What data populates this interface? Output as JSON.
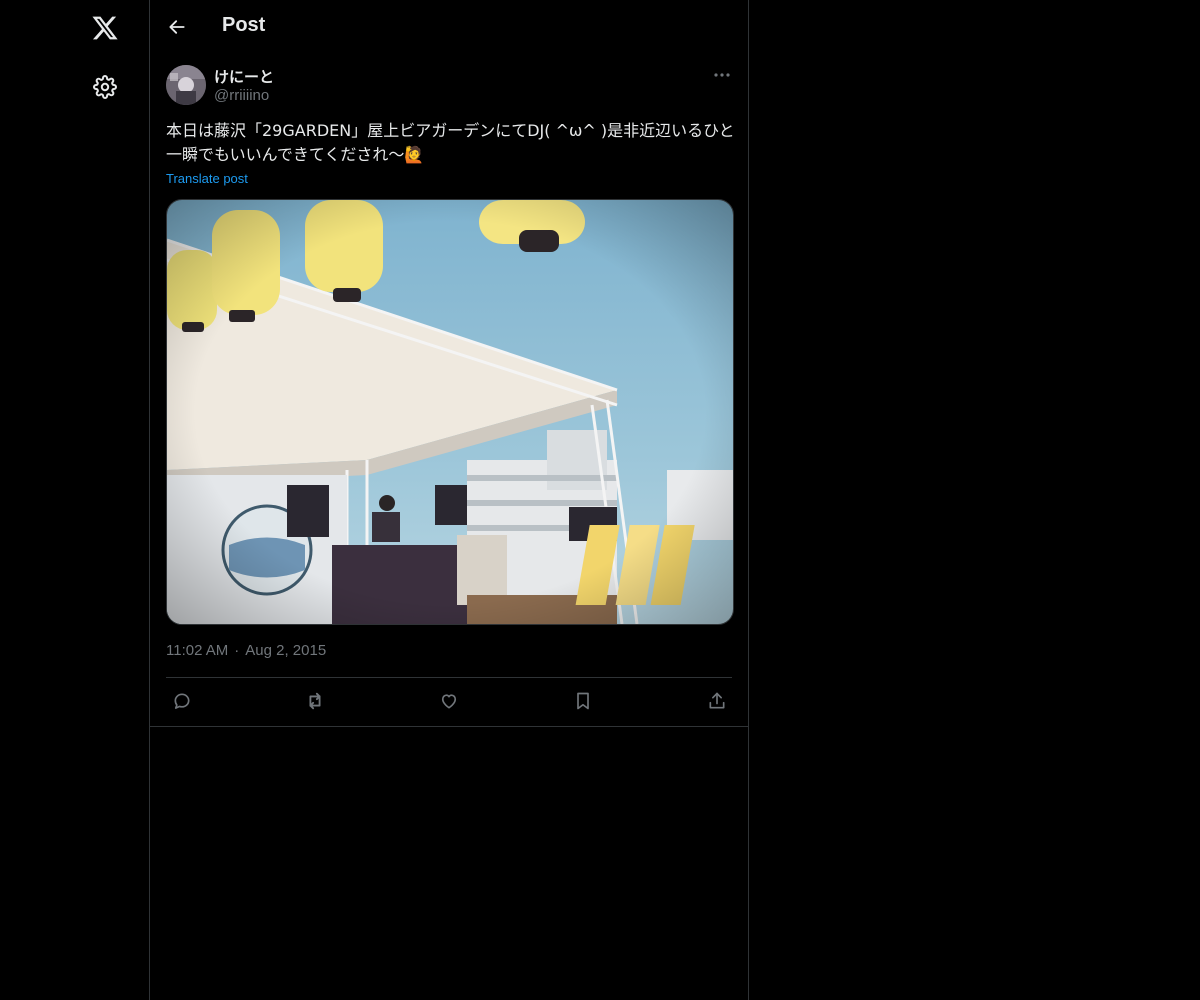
{
  "sidebar": {
    "logo_icon": "x-logo-icon",
    "settings_icon": "gear-icon"
  },
  "header": {
    "title": "Post",
    "back_icon": "arrow-left-icon"
  },
  "post": {
    "author": {
      "name": "けにーと",
      "handle": "@rriiiino"
    },
    "text": "本日は藤沢「29GARDEN」屋上ビアガーデンにてDJ( ^ω^ )是非近辺いるひと一瞬でもいいんできてくだされ〜🙋",
    "translate_label": "Translate post",
    "time": "11:02 AM",
    "separator": "·",
    "date": "Aug 2, 2015",
    "actions": [
      "reply-icon",
      "repost-icon",
      "like-icon",
      "bookmark-icon",
      "share-icon"
    ]
  },
  "colors": {
    "background": "#000000",
    "border": "#2f3336",
    "text_primary": "#e7e9ea",
    "text_secondary": "#71767b",
    "link": "#1d9bf0"
  }
}
